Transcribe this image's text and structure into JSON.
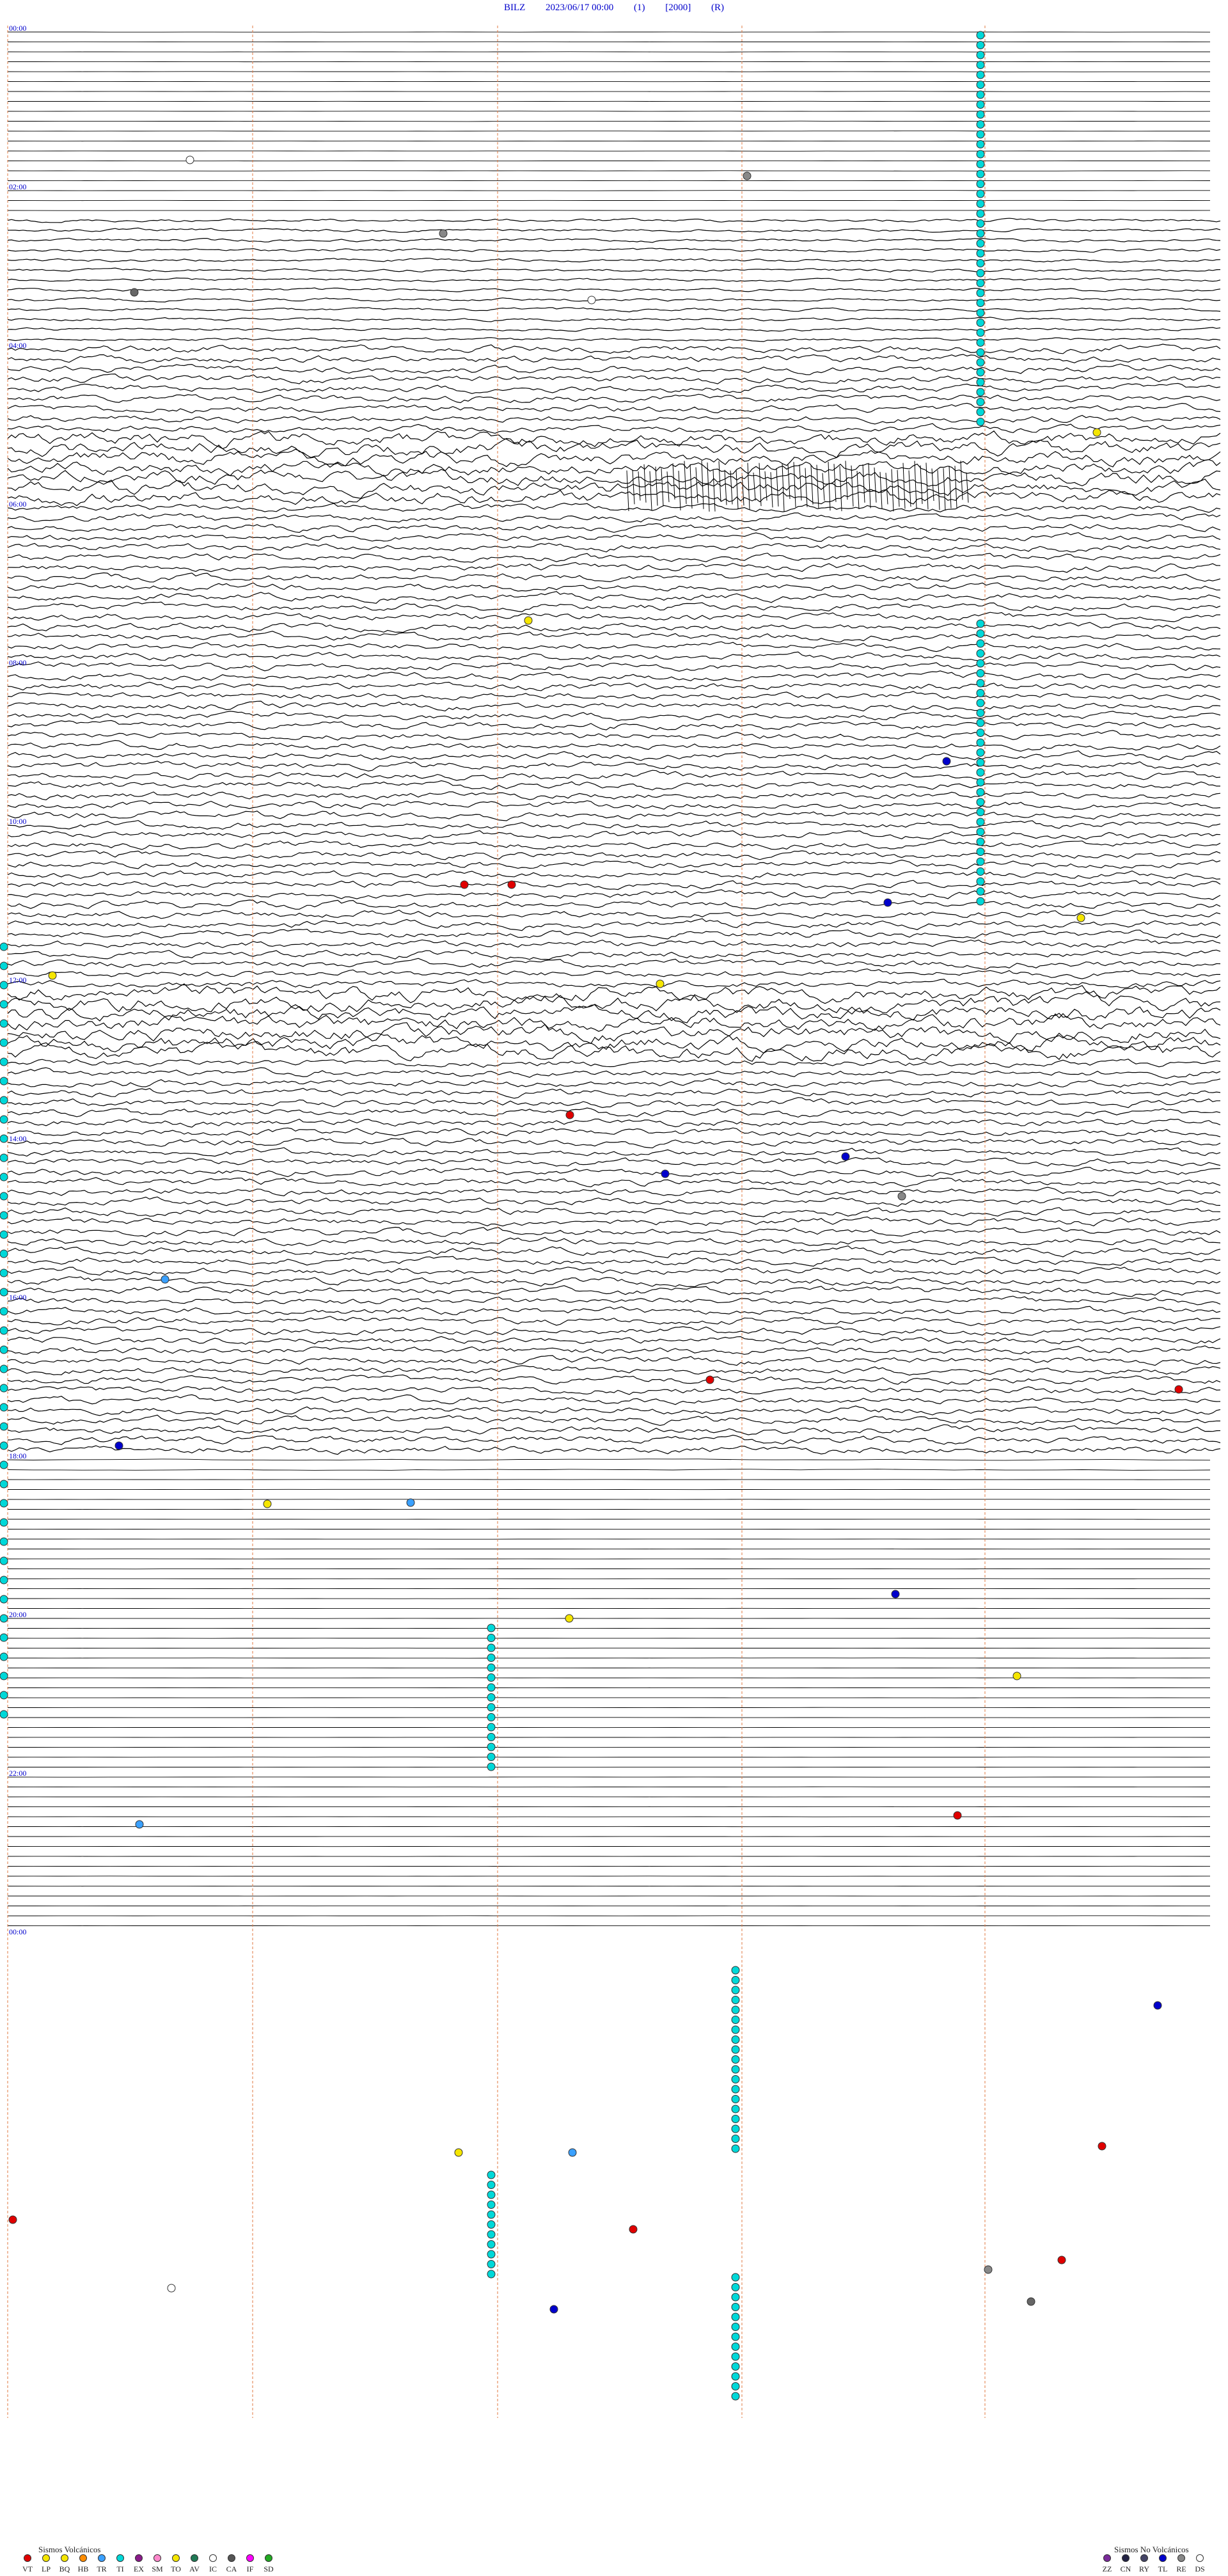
{
  "header": {
    "station": "BILZ",
    "datetime": "2023/06/17 00:00",
    "channel": "(1)",
    "scale": "[2000]",
    "mode": "(R)"
  },
  "time_labels": [
    "00:00",
    "",
    "02:00",
    "",
    "04:00",
    "",
    "06:00",
    "",
    "08:00",
    "",
    "10:00",
    "",
    "12:00",
    "",
    "14:00",
    "",
    "16:00",
    "",
    "18:00",
    "",
    "20:00",
    "",
    "22:00",
    "",
    "00:00"
  ],
  "legend_volcanic": {
    "title": "Sismos Volcánicos",
    "items": [
      {
        "code": "VT",
        "color": "#e00000"
      },
      {
        "code": "LP",
        "color": "#f5e600"
      },
      {
        "code": "BQ",
        "color": "#f5e600"
      },
      {
        "code": "HB",
        "color": "#ff8c00"
      },
      {
        "code": "TR",
        "color": "#3aa0ff"
      },
      {
        "code": "TI",
        "color": "#00d8d8"
      },
      {
        "code": "EX",
        "color": "#8a1a8a"
      },
      {
        "code": "SM",
        "color": "#ff88cc"
      },
      {
        "code": "TO",
        "color": "#f5e600"
      },
      {
        "code": "AV",
        "color": "#1f7a55"
      },
      {
        "code": "IC",
        "color": "#ffffff"
      },
      {
        "code": "CA",
        "color": "#555555"
      },
      {
        "code": "IF",
        "color": "#ff00ff"
      },
      {
        "code": "SD",
        "color": "#22aa22"
      }
    ]
  },
  "legend_non_volcanic": {
    "title": "Sismos No Volcánicos",
    "items": [
      {
        "code": "ZZ",
        "color": "#7a2a9a"
      },
      {
        "code": "CN",
        "color": "#222244"
      },
      {
        "code": "RY",
        "color": "#444466"
      },
      {
        "code": "TL",
        "color": "#0000cc"
      },
      {
        "code": "RE",
        "color": "#888888"
      },
      {
        "code": "DS",
        "color": "#ffffff"
      }
    ]
  },
  "colors": {
    "trace": "#000000",
    "marker_line": "#e07840",
    "time_label": "#0000cc",
    "ti_event": "#00d8d8"
  }
}
